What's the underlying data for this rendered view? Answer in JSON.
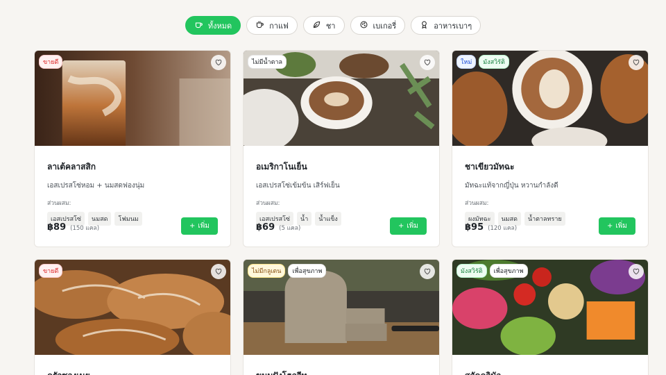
{
  "filters": [
    {
      "label": "ทั้งหมด",
      "icon": "cup-icon",
      "active": true
    },
    {
      "label": "กาแฟ",
      "icon": "coffee-icon",
      "active": false
    },
    {
      "label": "ชา",
      "icon": "leaf-icon",
      "active": false
    },
    {
      "label": "เบเกอรี่",
      "icon": "cookie-icon",
      "active": false
    },
    {
      "label": "อาหารเบาๆ",
      "icon": "award-icon",
      "active": false
    }
  ],
  "common": {
    "ingredients_label": "ส่วนผสม:",
    "add_label": "เพิ่ม"
  },
  "products": [
    {
      "name": "ลาเต้คลาสสิก",
      "desc": "เอสเปรสโซ่หอม + นมสดฟองนุ่ม",
      "badges": [
        "ขายดี"
      ],
      "ingredients": [
        "เอสเปรสโซ่",
        "นมสด",
        "โฟมนม"
      ],
      "price": "฿89",
      "kcal": "(150 แคล)"
    },
    {
      "name": "อเมริกาโนเย็น",
      "desc": "เอสเปรสโซ่เข้มข้น เสิร์ฟเย็น",
      "badges": [
        "ไม่มีน้ำตาล"
      ],
      "ingredients": [
        "เอสเปรสโซ่",
        "น้ำ",
        "น้ำแข็ง"
      ],
      "price": "฿69",
      "kcal": "(5 แคล)"
    },
    {
      "name": "ชาเขียวมัทฉะ",
      "desc": "มัทฉะแท้จากญี่ปุ่น หวานกำลังดี",
      "badges": [
        "ใหม่",
        "มังสวิรัติ"
      ],
      "ingredients": [
        "ผงมัทฉะ",
        "นมสด",
        "น้ำตาลทราย"
      ],
      "price": "฿95",
      "kcal": "(120 แคล)"
    },
    {
      "name": "ครัวซองเนย",
      "badges": [
        "ขายดี"
      ]
    },
    {
      "name": "ขนมปังโฮลวีท",
      "badges": [
        "ไม่มีกลูเตน",
        "เพื่อสุขภาพ"
      ]
    },
    {
      "name": "สลัดควินัว",
      "badges": [
        "มังสวิรัติ",
        "เพื่อสุขภาพ"
      ]
    }
  ]
}
